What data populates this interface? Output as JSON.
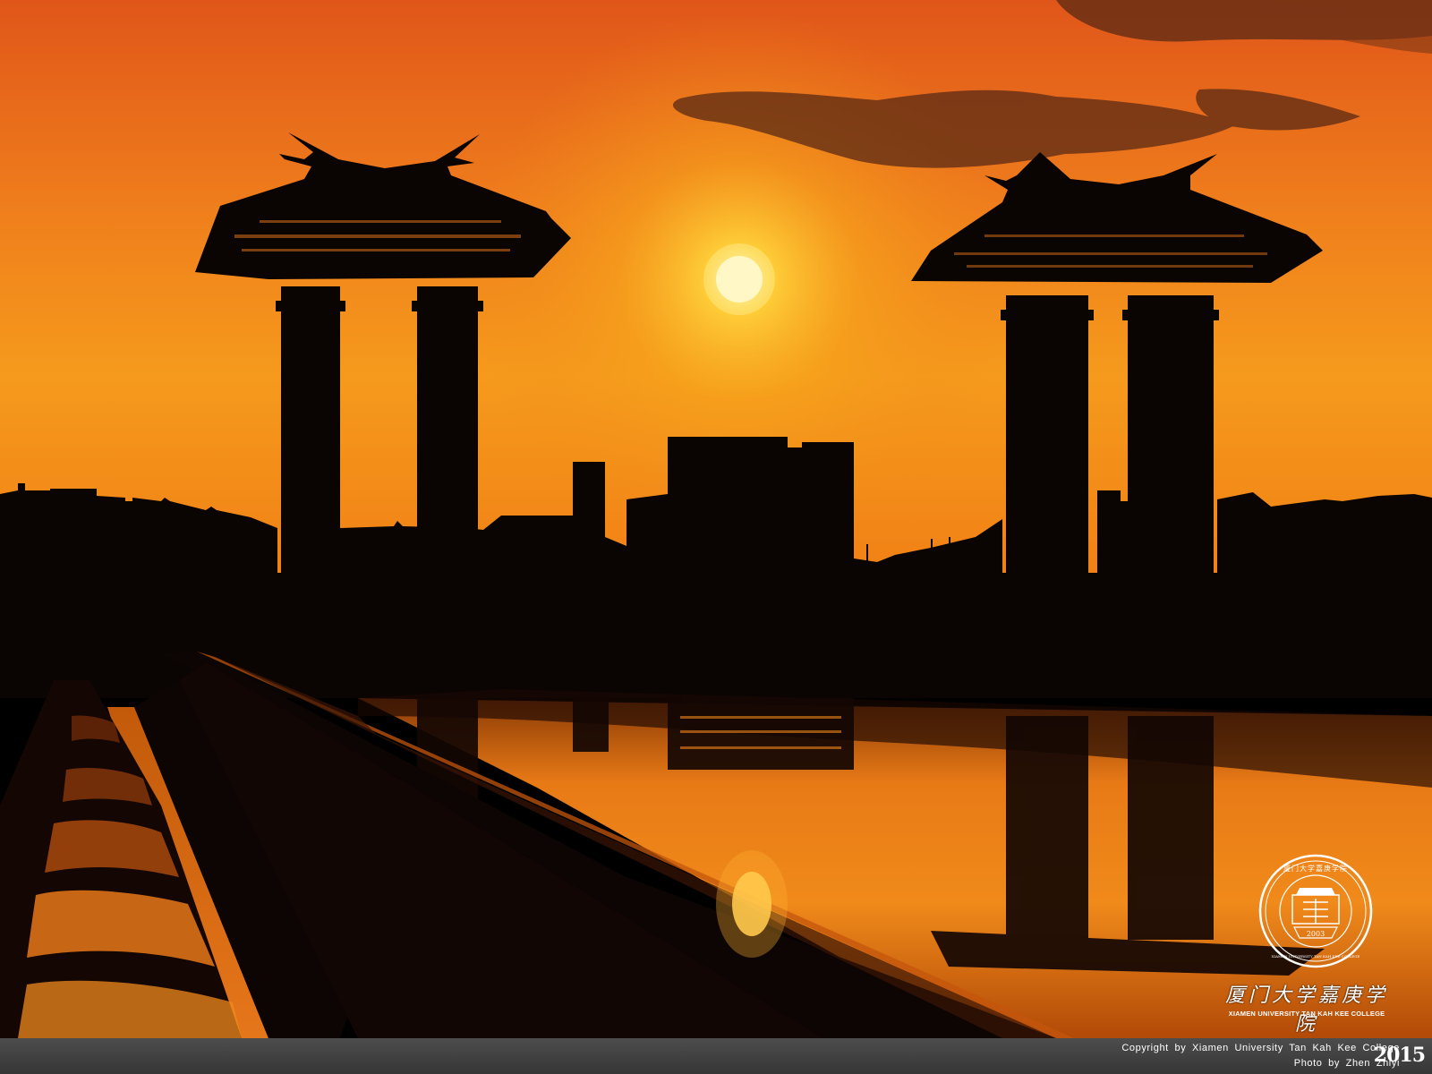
{
  "photo": {
    "subject": "Sunset over twin pagoda-roofed gate towers reflected in a pool"
  },
  "logo": {
    "seal_icon": "college-seal-icon",
    "seal_year": "2003",
    "seal_ring_top": "厦门大学嘉庚学院",
    "seal_ring_bottom": "XIAMEN UNIVERSITY TAN KAH KEE COLLEGE",
    "name_cn": "厦门大学嘉庚学院",
    "name_en": "XIAMEN UNIVERSITY TAN KAH KEE COLLEGE"
  },
  "footer": {
    "copyright": "Copyright by Xiamen University Tan Kah Kee College",
    "photo_credit": "Photo by Zhen Zhiyi",
    "year": "2015"
  },
  "colors": {
    "sky_top": "#e8641a",
    "sky_mid": "#f5a21c",
    "sun": "#fff8d0",
    "silhouette": "#0a0503",
    "water": "#f0851a"
  }
}
